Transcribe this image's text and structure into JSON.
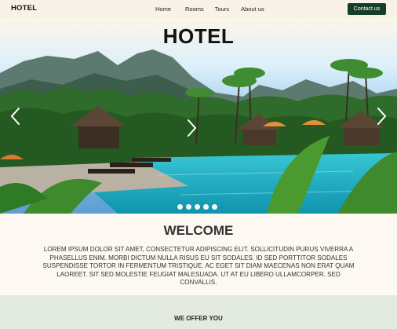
{
  "navbar": {
    "brand": "HOTEL",
    "links": [
      "Home",
      "Rooms",
      "Tours",
      "About us"
    ],
    "cta": "Contact us"
  },
  "hero": {
    "title": "HOTEL",
    "slides_total": 5,
    "active_slide": 1,
    "icons": [
      "chevron-left-icon",
      "chevron-right-icon"
    ]
  },
  "welcome": {
    "title": "WELCOME",
    "text": "Lorem ipsum dolor sit amet, consectetur adipiscing elit. Sollicitudin purus viverra a phasellus enim. Morbi dictum nulla risus eu sit sodales. Id sed porttitor sodales suspendisse tortor in fermentum tristique. Ac eget sit diam maecenas non erat quam laoreet. Sit sed molestie feugiat malesuada. Ut at eu libero ullamcorper. Sed convallis."
  },
  "offer": {
    "title": "WE OFFER YOU"
  },
  "colors": {
    "cta_bg": "#143d2a",
    "page_bg": "#fdf8f1",
    "offer_bg": "#e3ebe1",
    "pool": "#1fb3c4"
  }
}
